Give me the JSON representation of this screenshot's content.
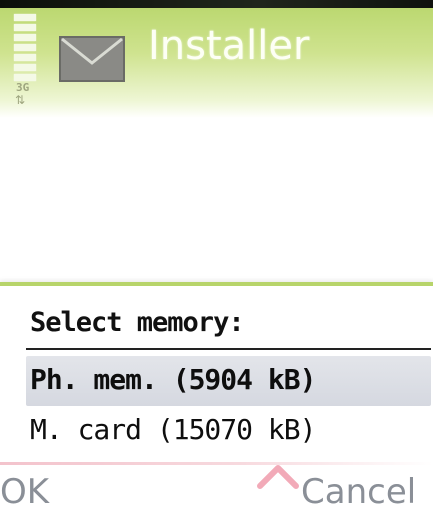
{
  "header": {
    "app_title": "Installer",
    "network_label": "3G",
    "network_icon": "transfer-arrows-icon",
    "app_icon": "envelope-icon",
    "signal_bars": 7
  },
  "dialog": {
    "heading": "Select memory:",
    "options": [
      {
        "label": "Ph. mem. (5904 kB)",
        "selected": true
      },
      {
        "label": "M. card (15070 kB)",
        "selected": false
      }
    ]
  },
  "softkeys": {
    "left": "OK",
    "right": "Cancel",
    "middle_icon": "scroll-up-indicator-icon"
  },
  "colors": {
    "theme_green": "#b7d46a",
    "selection": "#d8dbe2",
    "softkey_text": "#8a8f97",
    "accent_pink": "#f3c3cc"
  }
}
